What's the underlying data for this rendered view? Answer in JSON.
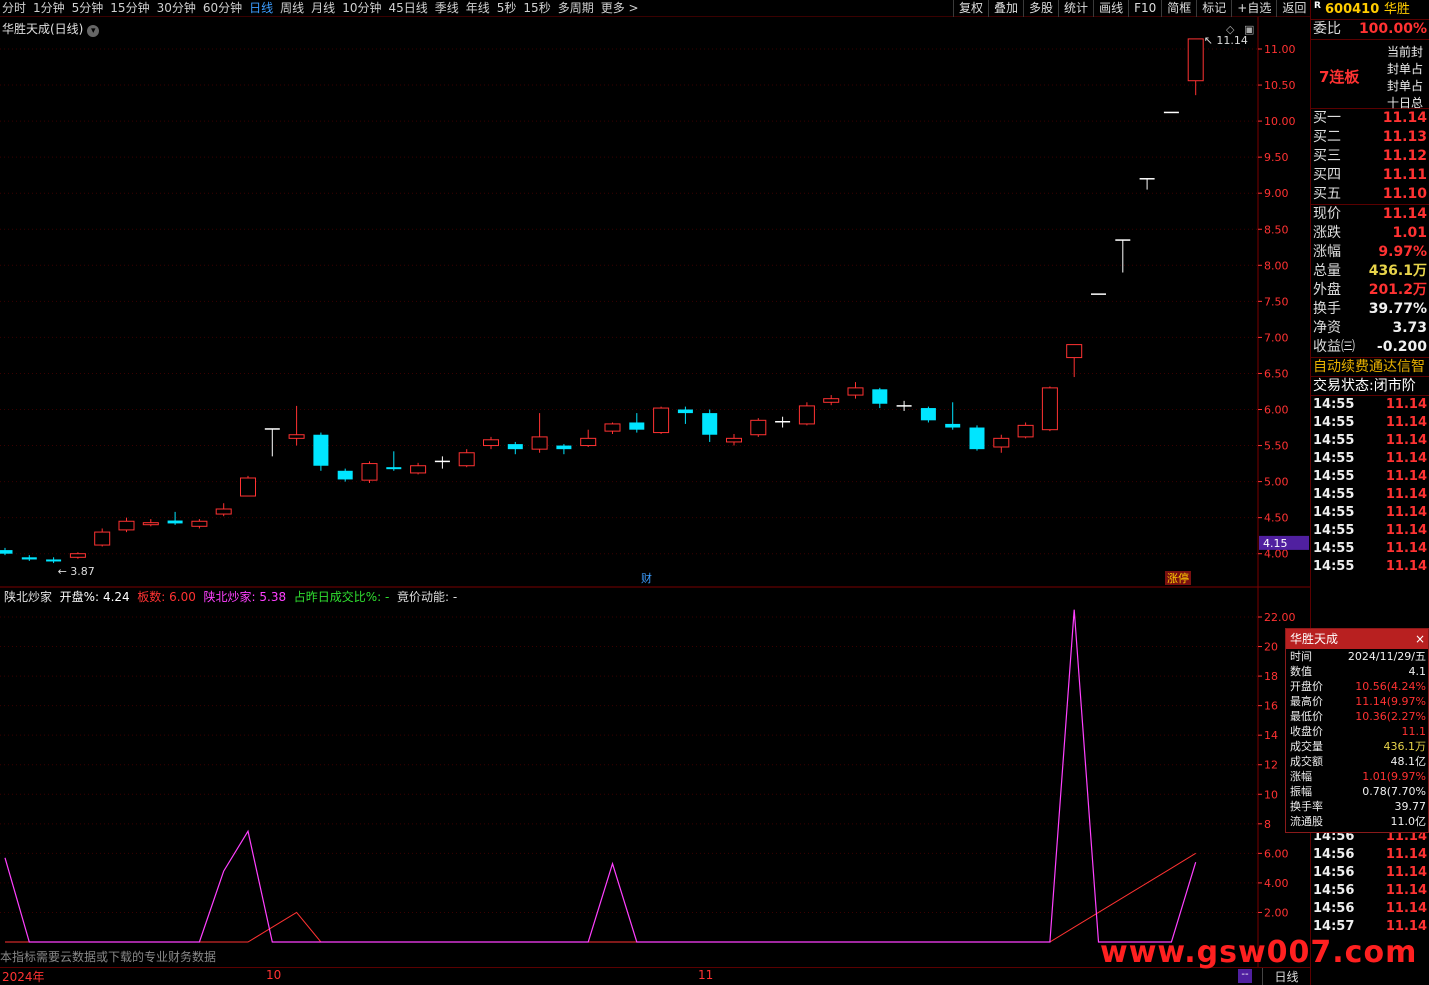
{
  "periods": [
    "分时",
    "1分钟",
    "5分钟",
    "15分钟",
    "30分钟",
    "60分钟",
    "日线",
    "周线",
    "月线",
    "10分钟",
    "45日线",
    "季线",
    "年线",
    "5秒",
    "15秒",
    "多周期",
    "更多 >"
  ],
  "active_period": "日线",
  "tools": [
    "复权",
    "叠加",
    "多股",
    "统计",
    "画线",
    "F10",
    "简框",
    "标记",
    "+自选",
    "返回"
  ],
  "chart_title": "华胜天成(日线)",
  "price_axis": [
    "11.00",
    "10.50",
    "10.00",
    "9.50",
    "9.00",
    "8.50",
    "8.00",
    "7.50",
    "7.00",
    "6.50",
    "6.00",
    "5.50",
    "5.00",
    "4.50",
    "4.00"
  ],
  "current_price_tag": "4.15",
  "high_label": "11.14",
  "low_label": "3.87",
  "event_cai": "财",
  "event_zt": "涨停",
  "indicator": {
    "name": "陕北炒家",
    "kp_label": "开盘%:",
    "kp_value": "4.24",
    "bs_label": "板数:",
    "bs_value": "6.00",
    "sb_label": "陕北炒家:",
    "sb_value": "5.38",
    "zr_label": "占昨日成交比%:",
    "zr_value": "-",
    "jj_label": "竟价动能:",
    "jj_value": "-"
  },
  "ind_axis": [
    "22.00",
    "20",
    "18",
    "16",
    "14",
    "12",
    "10",
    "8",
    "6.00",
    "4.00",
    "2.00"
  ],
  "notice": "本指标需要云数据或下载的专业财务数据",
  "date_labels": [
    "2024年",
    "10",
    "11"
  ],
  "bottom_tag": "日线",
  "colors": {
    "up": "#ff3232",
    "down": "#00e5ff",
    "axis": "#ff3232"
  },
  "right": {
    "code": "600410",
    "name": "华胜",
    "weibi_label": "委比",
    "weibi_value": "100.00%",
    "lianban": "7连板",
    "limit_lines": [
      "当前封",
      "封单占",
      "封单占",
      "十日总"
    ],
    "bids": [
      [
        "买一",
        "11.14"
      ],
      [
        "买二",
        "11.13"
      ],
      [
        "买三",
        "11.12"
      ],
      [
        "买四",
        "11.11"
      ],
      [
        "买五",
        "11.10"
      ]
    ],
    "stats": [
      [
        "现价",
        "11.14",
        "red"
      ],
      [
        "涨跌",
        "1.01",
        "red"
      ],
      [
        "涨幅",
        "9.97%",
        "red"
      ],
      [
        "总量",
        "436.1万",
        "yel"
      ],
      [
        "外盘",
        "201.2万",
        "red"
      ],
      [
        "换手",
        "39.77%",
        "wht"
      ],
      [
        "净资",
        "3.73",
        "wht"
      ],
      [
        "收益㈢",
        "-0.200",
        "wht"
      ]
    ],
    "auto_renew": "自动续费通达信智",
    "trade_status": "交易状态:闭市阶",
    "ticks": [
      [
        "14:55",
        "11.14"
      ],
      [
        "14:55",
        "11.14"
      ],
      [
        "14:55",
        "11.14"
      ],
      [
        "14:55",
        "11.14"
      ],
      [
        "14:55",
        "11.14"
      ],
      [
        "14:55",
        "11.14"
      ],
      [
        "14:55",
        "11.14"
      ],
      [
        "14:55",
        "11.14"
      ],
      [
        "14:55",
        "11.14"
      ],
      [
        "14:55",
        "11.14"
      ]
    ],
    "ticks2": [
      [
        "14:56",
        "11.14"
      ],
      [
        "14:56",
        "11.14"
      ],
      [
        "14:56",
        "11.14"
      ],
      [
        "14:56",
        "11.14"
      ],
      [
        "14:56",
        "11.14"
      ],
      [
        "14:56",
        "11.14"
      ],
      [
        "14:56",
        "11.14"
      ],
      [
        "14:57",
        "11.14"
      ]
    ]
  },
  "popup": {
    "title": "华胜天成",
    "rows": [
      [
        "时间",
        "2024/11/29/五",
        "wht"
      ],
      [
        "数值",
        "4.1",
        "wht"
      ],
      [
        "开盘价",
        "10.56(4.24%",
        "red"
      ],
      [
        "最高价",
        "11.14(9.97%",
        "red"
      ],
      [
        "最低价",
        "10.36(2.27%",
        "red"
      ],
      [
        "收盘价",
        "11.1",
        "red"
      ],
      [
        "成交量",
        "436.1万",
        "yel"
      ],
      [
        "成交额",
        "48.1亿",
        "wht"
      ],
      [
        "涨幅",
        "1.01(9.97%",
        "red"
      ],
      [
        "振幅",
        "0.78(7.70%",
        "wht"
      ],
      [
        "换手率",
        "39.77",
        "wht"
      ],
      [
        "流通股",
        "11.0亿",
        "wht"
      ]
    ]
  },
  "watermark": "www.gsw007.com",
  "candles": [
    [
      4.05,
      4.0,
      4.08,
      3.98
    ],
    [
      3.95,
      3.92,
      3.98,
      3.9
    ],
    [
      3.92,
      3.9,
      3.95,
      3.87
    ],
    [
      3.95,
      4.0,
      4.02,
      3.93
    ],
    [
      4.12,
      4.3,
      4.35,
      4.1
    ],
    [
      4.33,
      4.45,
      4.5,
      4.3
    ],
    [
      4.42,
      4.43,
      4.48,
      4.38
    ],
    [
      4.46,
      4.42,
      4.58,
      4.4
    ],
    [
      4.38,
      4.45,
      4.48,
      4.35
    ],
    [
      4.55,
      4.62,
      4.7,
      4.52
    ],
    [
      4.8,
      5.05,
      5.08,
      4.8
    ],
    [
      5.73,
      5.73,
      5.73,
      5.35
    ],
    [
      5.6,
      5.65,
      6.05,
      5.5
    ],
    [
      5.65,
      5.22,
      5.68,
      5.15
    ],
    [
      5.15,
      5.03,
      5.18,
      5.0
    ],
    [
      5.02,
      5.25,
      5.28,
      4.98
    ],
    [
      5.2,
      5.18,
      5.42,
      5.15
    ],
    [
      5.12,
      5.22,
      5.26,
      5.1
    ],
    [
      5.28,
      5.28,
      5.35,
      5.18
    ],
    [
      5.22,
      5.4,
      5.45,
      5.2
    ],
    [
      5.5,
      5.58,
      5.62,
      5.45
    ],
    [
      5.52,
      5.45,
      5.55,
      5.38
    ],
    [
      5.45,
      5.62,
      5.95,
      5.4
    ],
    [
      5.5,
      5.45,
      5.52,
      5.38
    ],
    [
      5.5,
      5.6,
      5.72,
      5.48
    ],
    [
      5.7,
      5.8,
      5.82,
      5.66
    ],
    [
      5.82,
      5.72,
      5.95,
      5.68
    ],
    [
      5.68,
      6.02,
      6.04,
      5.66
    ],
    [
      6.0,
      5.95,
      6.04,
      5.8
    ],
    [
      5.95,
      5.65,
      6.0,
      5.55
    ],
    [
      5.55,
      5.6,
      5.66,
      5.5
    ],
    [
      5.65,
      5.85,
      5.88,
      5.62
    ],
    [
      5.83,
      5.83,
      5.9,
      5.75
    ],
    [
      5.8,
      6.05,
      6.1,
      5.78
    ],
    [
      6.1,
      6.15,
      6.2,
      6.06
    ],
    [
      6.2,
      6.3,
      6.38,
      6.15
    ],
    [
      6.28,
      6.08,
      6.3,
      6.02
    ],
    [
      6.05,
      6.05,
      6.12,
      5.98
    ],
    [
      6.02,
      5.85,
      6.04,
      5.82
    ],
    [
      5.8,
      5.75,
      6.1,
      5.72
    ],
    [
      5.75,
      5.45,
      5.78,
      5.43
    ],
    [
      5.48,
      5.6,
      5.65,
      5.4
    ],
    [
      5.62,
      5.78,
      5.82,
      5.6
    ],
    [
      5.72,
      6.3,
      6.32,
      5.7
    ],
    [
      6.72,
      6.9,
      6.9,
      6.45
    ],
    [
      7.6,
      7.6,
      7.6,
      7.6
    ],
    [
      8.35,
      8.35,
      8.35,
      7.9
    ],
    [
      9.2,
      9.2,
      9.2,
      9.05
    ],
    [
      10.12,
      10.12,
      10.12,
      10.12
    ],
    [
      10.56,
      11.14,
      11.14,
      10.36
    ]
  ],
  "ind_magenta": [
    5.7,
    0,
    0,
    0,
    0,
    0,
    0,
    0,
    0,
    4.8,
    7.5,
    0,
    0,
    0,
    0,
    0,
    0,
    0,
    0,
    0,
    0,
    0,
    0,
    0,
    0,
    5.3,
    0,
    0,
    0,
    0,
    0,
    0,
    0,
    0,
    0,
    0,
    0,
    0,
    0,
    0,
    0,
    0,
    0,
    0,
    22.5,
    0,
    0,
    0,
    0,
    5.4
  ],
  "ind_red": [
    0,
    0,
    0,
    0,
    0,
    0,
    0,
    0,
    0,
    0,
    0,
    1,
    2,
    0,
    0,
    0,
    0,
    0,
    0,
    0,
    0,
    0,
    0,
    0,
    0,
    0,
    0,
    0,
    0,
    0,
    0,
    0,
    0,
    0,
    0,
    0,
    0,
    0,
    0,
    0,
    0,
    0,
    0,
    0,
    1,
    2,
    3,
    4,
    5,
    6
  ]
}
